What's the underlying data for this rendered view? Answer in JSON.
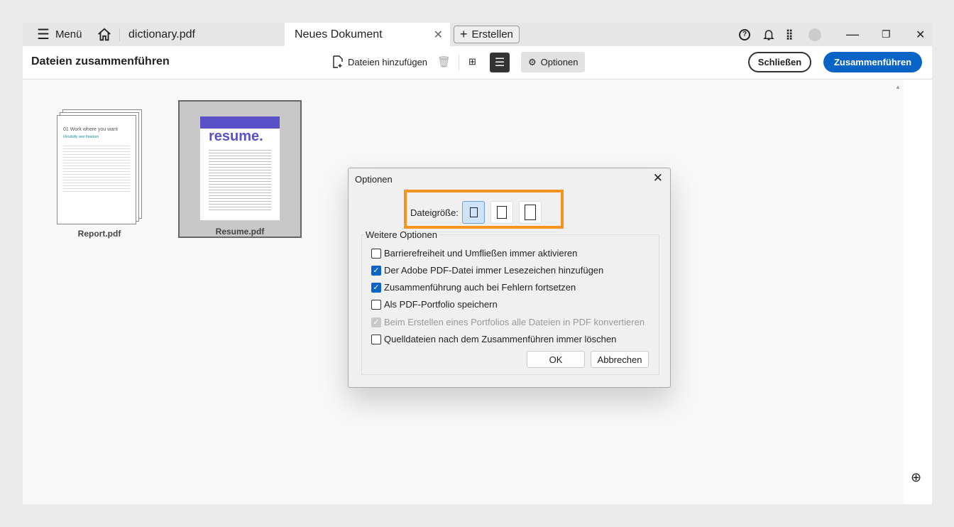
{
  "tabbar": {
    "menu_label": "Menü",
    "tab1": "dictionary.pdf",
    "tab2": "Neues Dokument",
    "create_label": "Erstellen"
  },
  "toolbar": {
    "title": "Dateien zusammenführen",
    "add_files": "Dateien hinzufügen",
    "options": "Optionen",
    "close": "Schließen",
    "merge": "Zusammenführen"
  },
  "files": [
    {
      "name": "Report.pdf",
      "heading": "01 Work where you want",
      "subheading": "Flexibility and freedom"
    },
    {
      "name": "Resume.pdf",
      "heading": "resume."
    }
  ],
  "dialog": {
    "title": "Optionen",
    "filesize_label": "Dateigröße:",
    "group_label": "Weitere Optionen",
    "options": [
      {
        "label": "Barrierefreiheit und Umfließen immer aktivieren",
        "checked": false
      },
      {
        "label": "Der Adobe PDF-Datei immer Lesezeichen hinzufügen",
        "checked": true
      },
      {
        "label": "Zusammenführung auch bei Fehlern fortsetzen",
        "checked": true
      },
      {
        "label": "Als PDF-Portfolio speichern",
        "checked": false
      },
      {
        "label": "Beim Erstellen eines Portfolios alle Dateien in PDF konvertieren",
        "checked": true,
        "disabled": true
      },
      {
        "label": "Quelldateien nach dem Zusammenführen immer löschen",
        "checked": false
      }
    ],
    "ok": "OK",
    "cancel": "Abbrechen"
  },
  "colors": {
    "accent": "#0a64c8",
    "highlight": "#f7931e",
    "resume_banner": "#5a50c8"
  }
}
